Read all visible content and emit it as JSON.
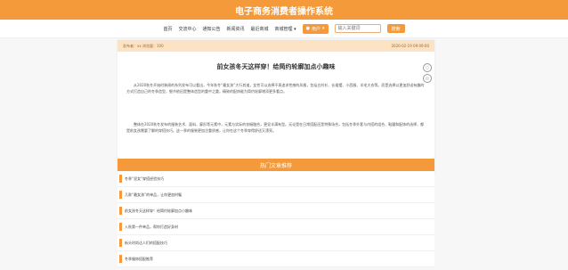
{
  "site": {
    "title": "电子商务消费者操作系统"
  },
  "nav": {
    "items": [
      "首页",
      "交流中心",
      "通知公告",
      "新闻资讯",
      "最近商城",
      "商城管理"
    ],
    "manage_arrow": "▾",
    "user_label": "用户",
    "search_placeholder": "输入关键词",
    "search_button": "搜索"
  },
  "article": {
    "meta_left": "发布者：xx  浏览量：100",
    "meta_right": "2020-02-19 09:09:00",
    "title": "前女孩冬天这样穿！给简约轮廓加点小趣味",
    "paragraphs": [
      "从2020秋冬开始时装周的系列发布可以看出，今年秋冬“最女孩”大行其道，女性可以选择不再追求性感的风格，包括白衬衫、长裙摆、小西服、羊毛大衣等。而是选择以更加舒适有趣的方式打造自己的冬季造型，细节依旧是整体造型的重中之重，精致的配饰能为简约轮廓增添更多看点。",
      "整体在2020秋冬发布的服装艺术、面料、廓形等元素中，元素与实际的衣橱融合，更显丰满有型。无论是在日常搭配还是特殊场合，包括冬季外套与内搭的组合、鞋履和配饰的选择，都是前女孩需要了解的穿搭技巧。这一季的服装更加注重质感，让你在这个冬季穿得舒适又漂亮。"
    ]
  },
  "hot": {
    "title": "热门文章推荐",
    "items": [
      "冬季“显女”穿搭经验技巧",
      "几款“最女孩”的单品，让你更加时髦",
      "前女孩冬天这样穿！给简约轮廓加点小趣味",
      "入秋第一件单品，帮你打造好身材",
      "街头时尚达人们的搭配技巧",
      "冬季服饰搭配推荐"
    ]
  },
  "colors": {
    "accent": "#f59a3a",
    "meta_bg": "#fbe3c3"
  }
}
